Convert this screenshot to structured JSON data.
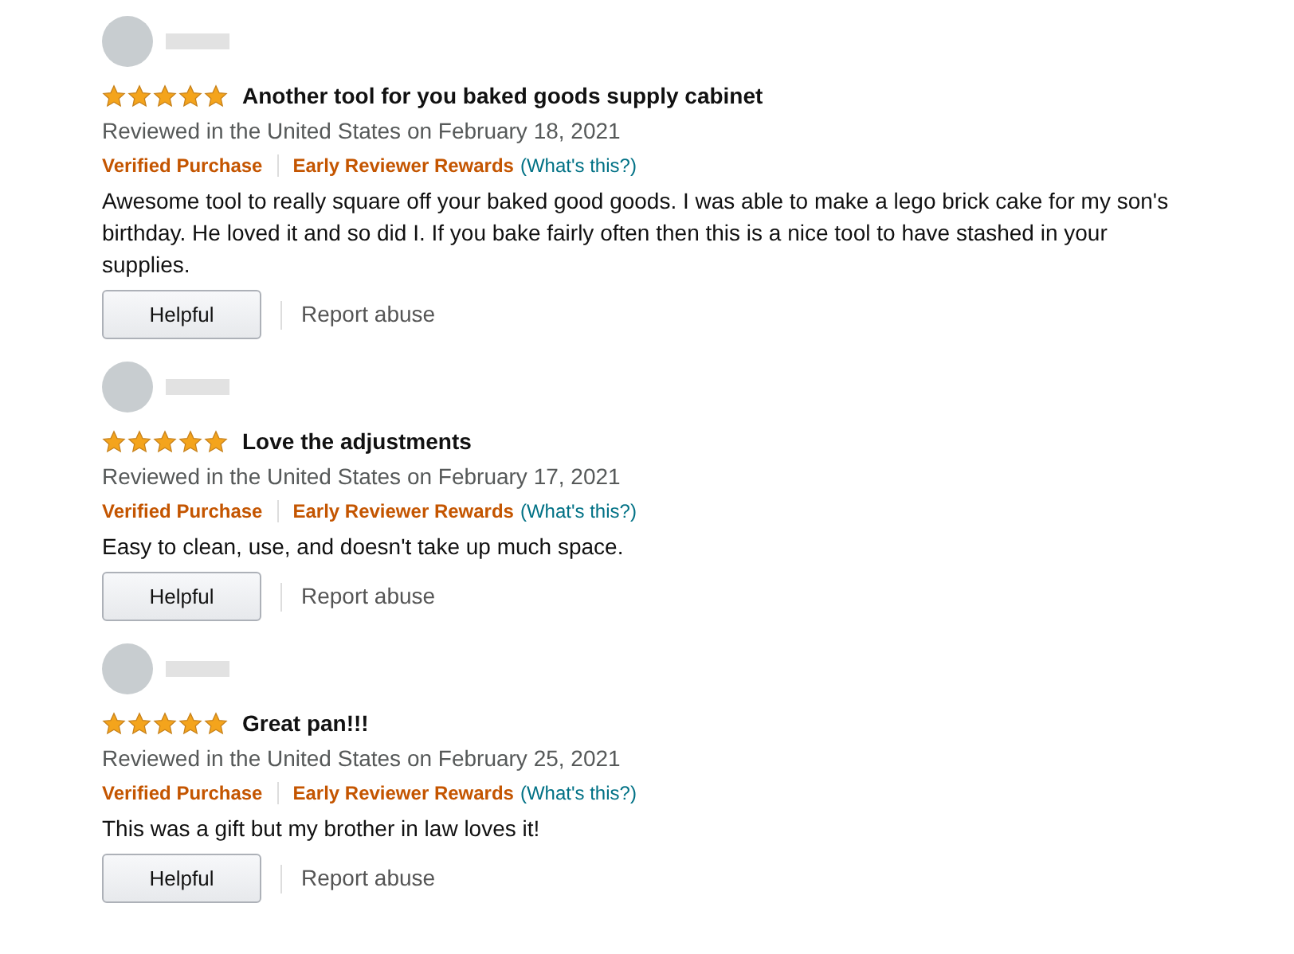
{
  "reviews": [
    {
      "stars": 5,
      "title": "Another tool for you baked goods supply cabinet",
      "date": "Reviewed in the United States on February 18, 2021",
      "verified": "Verified Purchase",
      "reward": "Early Reviewer Rewards",
      "whats_this": "(What's this?)",
      "body": "Awesome tool to really square off your baked good goods. I was able to make a lego brick cake for my son's birthday. He loved it and so did I. If you bake fairly often then this is a nice tool to have stashed in your supplies.",
      "helpful": "Helpful",
      "report": "Report abuse"
    },
    {
      "stars": 5,
      "title": "Love the adjustments",
      "date": "Reviewed in the United States on February 17, 2021",
      "verified": "Verified Purchase",
      "reward": "Early Reviewer Rewards",
      "whats_this": "(What's this?)",
      "body": "Easy to clean, use, and doesn't take up much space.",
      "helpful": "Helpful",
      "report": "Report abuse"
    },
    {
      "stars": 5,
      "title": "Great pan!!!",
      "date": "Reviewed in the United States on February 25, 2021",
      "verified": "Verified Purchase",
      "reward": "Early Reviewer Rewards",
      "whats_this": "(What's this?)",
      "body": "This was a gift but my brother in law loves it!",
      "helpful": "Helpful",
      "report": "Report abuse"
    }
  ]
}
